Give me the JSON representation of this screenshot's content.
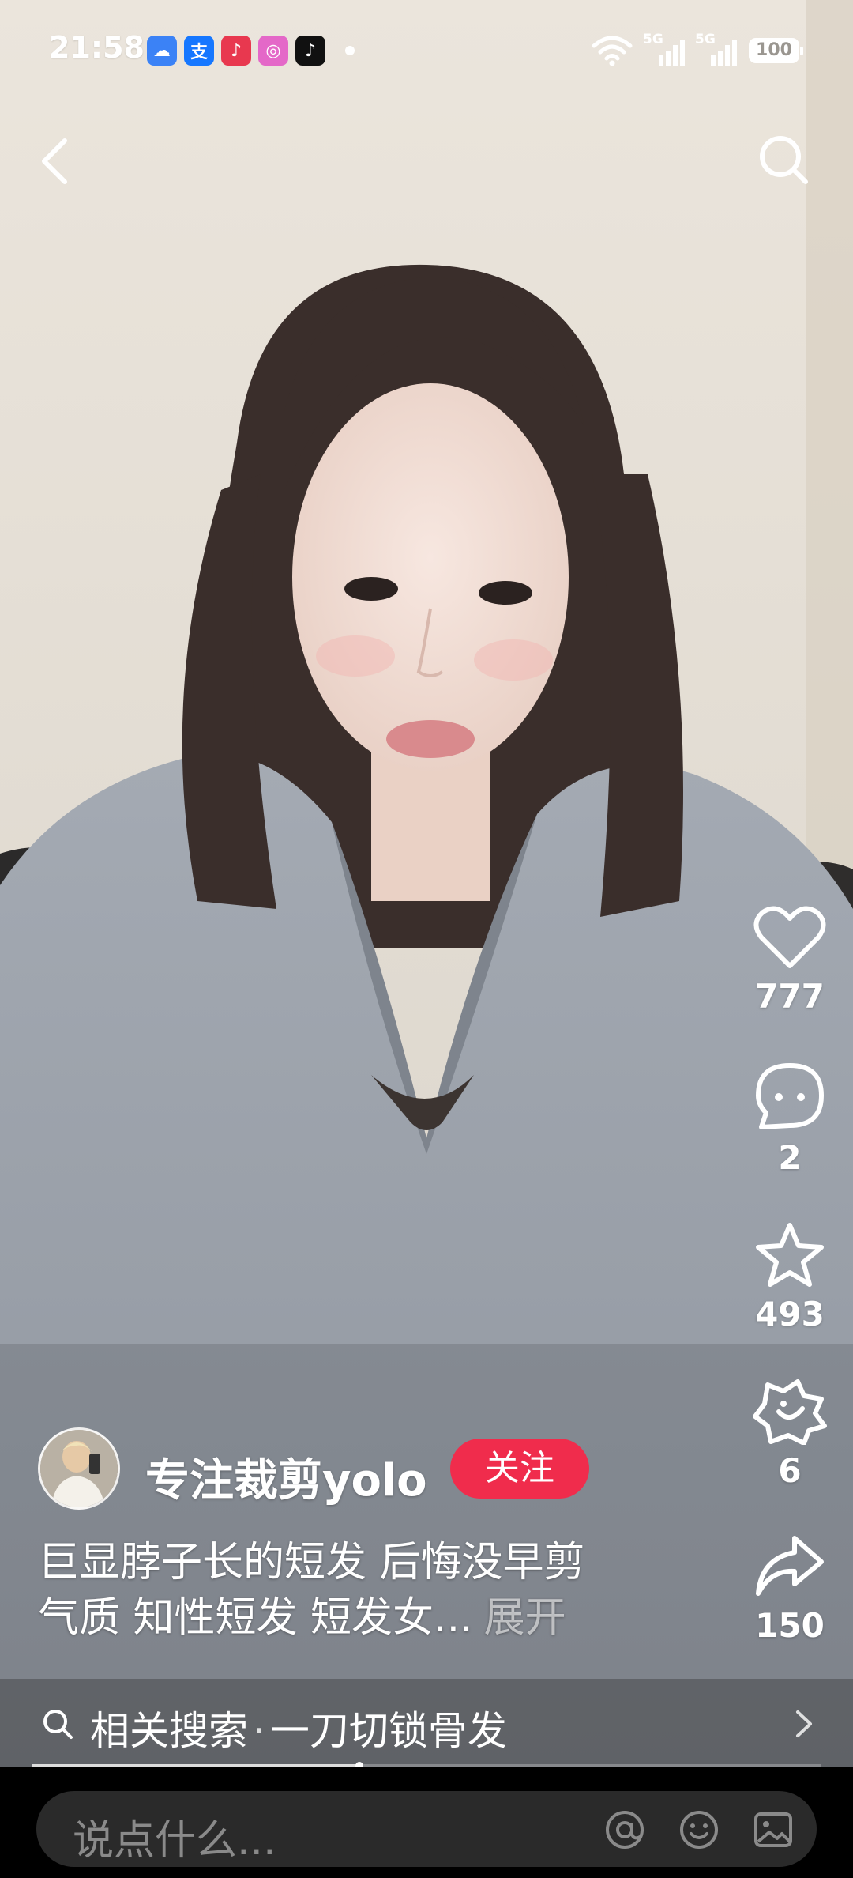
{
  "status_bar": {
    "time": "21:58",
    "notification_apps": [
      {
        "icon": "cloud-weather-icon",
        "glyph": "☁",
        "color": "#3b82f6"
      },
      {
        "icon": "alipay-icon",
        "glyph": "支",
        "color": "#1677ff"
      },
      {
        "icon": "music-icon",
        "glyph": "♪",
        "color": "#e8384f"
      },
      {
        "icon": "camera-app-icon",
        "glyph": "◎",
        "color": "#e468c8"
      },
      {
        "icon": "douyin-icon",
        "glyph": "♪",
        "color": "#111111"
      }
    ],
    "network_1": "5G",
    "network_2": "5G",
    "battery": "100"
  },
  "nav": {
    "back_icon": "back-arrow-icon",
    "search_icon": "search-icon"
  },
  "actions": {
    "like": {
      "icon": "heart-icon",
      "count": "777"
    },
    "comment": {
      "icon": "comment-icon",
      "count": "2"
    },
    "favorite": {
      "icon": "star-icon",
      "count": "493"
    },
    "remix": {
      "icon": "remix-icon",
      "count": "6"
    },
    "share": {
      "icon": "share-icon",
      "count": "150"
    }
  },
  "author": {
    "name": "专注裁剪yolo",
    "follow_label": "关注"
  },
  "caption": {
    "line1": "巨显脖子长的短发 后悔没早剪",
    "line2": "气质 知性短发 短发女...",
    "expand_label": "展开"
  },
  "related_search": {
    "prefix": "相关搜索",
    "separator": "·",
    "query": "一刀切锁骨发"
  },
  "playback": {
    "progress": 0.415
  },
  "comment_bar": {
    "placeholder": "说点什么...",
    "mention_icon": "at-mention-icon",
    "emoji_icon": "emoji-icon",
    "image_icon": "image-icon"
  },
  "colors": {
    "accent": "#f02c4c",
    "background": "#000000"
  }
}
